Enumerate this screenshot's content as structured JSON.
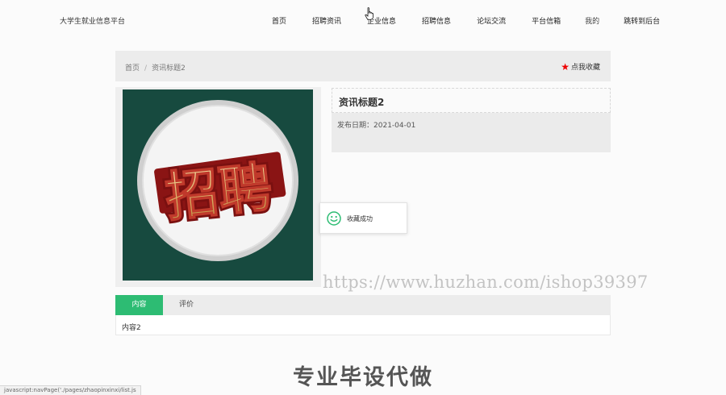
{
  "site": {
    "title": "大学生就业信息平台"
  },
  "nav": {
    "items": [
      {
        "label": "首页",
        "x": 0
      },
      {
        "label": "招聘资讯",
        "x": 0
      },
      {
        "label": "企业信息",
        "x": 0
      },
      {
        "label": "招聘信息",
        "x": 0
      },
      {
        "label": "论坛交流",
        "x": 0
      },
      {
        "label": "平台信箱",
        "x": 0
      },
      {
        "label": "我的",
        "x": 0
      },
      {
        "label": "跳转到后台",
        "x": 0
      }
    ]
  },
  "breadcrumb": {
    "home": "首页",
    "separator": "/",
    "current": "资讯标题2"
  },
  "favorite": {
    "label": "点我收藏",
    "icon": "star-icon",
    "icon_color": "#e00000"
  },
  "detail": {
    "title": "资讯标题2",
    "date_label": "发布日期：",
    "date_value": "2021-04-01"
  },
  "poster": {
    "text": "招聘"
  },
  "toast": {
    "text": "收藏成功",
    "icon": "smile-icon",
    "icon_color": "#2dbc73"
  },
  "watermark": "https://www.huzhan.com/ishop39397",
  "tabs": {
    "content_label": "内容",
    "review_label": "评价",
    "active_color": "#2dbc73"
  },
  "content": {
    "text": "内容2"
  },
  "overlay_caption": "专业毕设代做",
  "status_bar": "javascript:navPage('./pages/zhaopinxinxi/list.js"
}
